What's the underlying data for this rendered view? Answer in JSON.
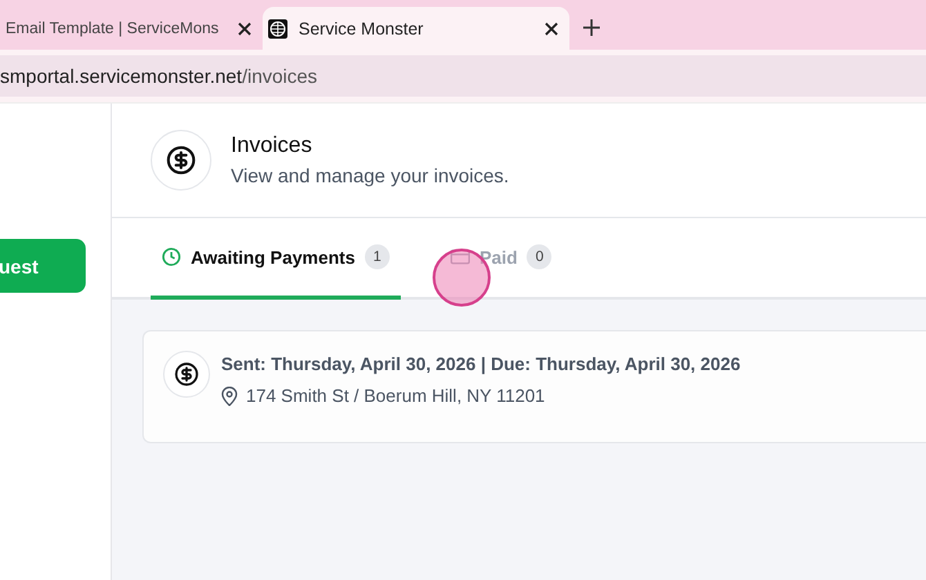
{
  "browser_tabs": [
    {
      "title": "Email Template | ServiceMons",
      "selected": false
    },
    {
      "title": "Service Monster",
      "selected": true
    }
  ],
  "address_bar": {
    "host": "smportal.servicemonster.net",
    "path": "/invoices"
  },
  "sidebar": {
    "button": "uest"
  },
  "header": {
    "title": "Invoices",
    "subtitle": "View and manage your invoices."
  },
  "tabs": [
    {
      "label": "Awaiting Payments",
      "count": "1",
      "kind": "clock",
      "selected": true
    },
    {
      "label": "Paid",
      "count": "0",
      "kind": "card",
      "selected": false
    }
  ],
  "invoices": [
    {
      "dates": "Sent: Thursday, April 30, 2026 | Due: Thursday, April 30, 2026",
      "address": "174 Smith St / Boerum Hill, NY 11201"
    }
  ]
}
